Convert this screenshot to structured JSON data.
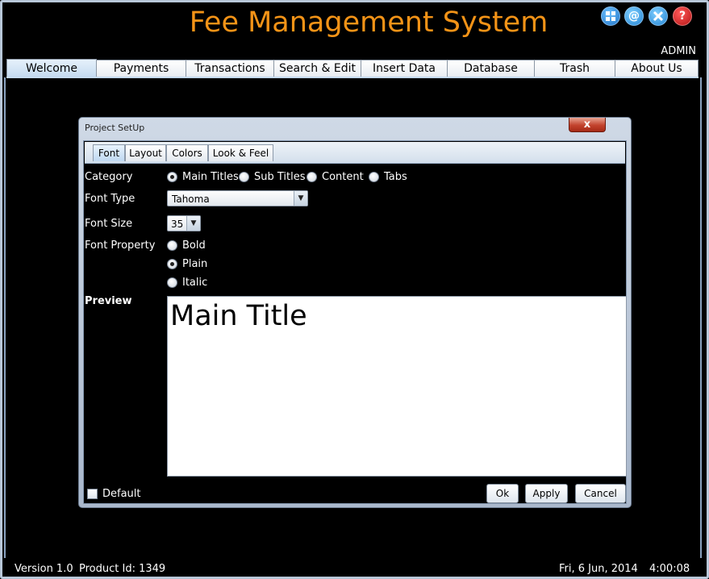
{
  "app": {
    "title": "Fee Management System",
    "user": "ADMIN",
    "icons": [
      "apps-icon",
      "email-icon",
      "tools-icon",
      "help-icon"
    ]
  },
  "tabs": [
    {
      "label": "Welcome",
      "active": true
    },
    {
      "label": "Payments",
      "active": false
    },
    {
      "label": "Transactions",
      "active": false
    },
    {
      "label": "Search & Edit",
      "active": false
    },
    {
      "label": "Insert Data",
      "active": false
    },
    {
      "label": "Database",
      "active": false
    },
    {
      "label": "Trash",
      "active": false
    },
    {
      "label": "About Us",
      "active": false
    }
  ],
  "dialog": {
    "title": "Project SetUp",
    "close_label": "x",
    "subtabs": [
      {
        "label": "Font",
        "active": true
      },
      {
        "label": "Layout",
        "active": false
      },
      {
        "label": "Colors",
        "active": false
      },
      {
        "label": "Look & Feel",
        "active": false
      }
    ],
    "category_label": "Category",
    "category_options": [
      {
        "label": "Main Titles",
        "checked": true
      },
      {
        "label": "Sub Titles",
        "checked": false
      },
      {
        "label": "Content",
        "checked": false
      },
      {
        "label": "Tabs",
        "checked": false
      }
    ],
    "font_type_label": "Font Type",
    "font_type_value": "Tahoma",
    "font_size_label": "Font Size",
    "font_size_value": "35",
    "font_property_label": "Font Property",
    "font_property_options": [
      {
        "label": "Bold",
        "checked": false
      },
      {
        "label": "Plain",
        "checked": true
      },
      {
        "label": "Italic",
        "checked": false
      }
    ],
    "preview_label": "Preview",
    "preview_text": "Main Title",
    "default_label": "Default",
    "default_checked": false,
    "ok_label": "Ok",
    "apply_label": "Apply",
    "cancel_label": "Cancel"
  },
  "status": {
    "version": "Version 1.0",
    "product_id": "Product Id: 1349",
    "date": "Fri, 6 Jun, 2014",
    "time": "4:00:08"
  },
  "colors": {
    "title": "#f39317",
    "background": "#000000",
    "tab_active": "#c4daf0"
  }
}
